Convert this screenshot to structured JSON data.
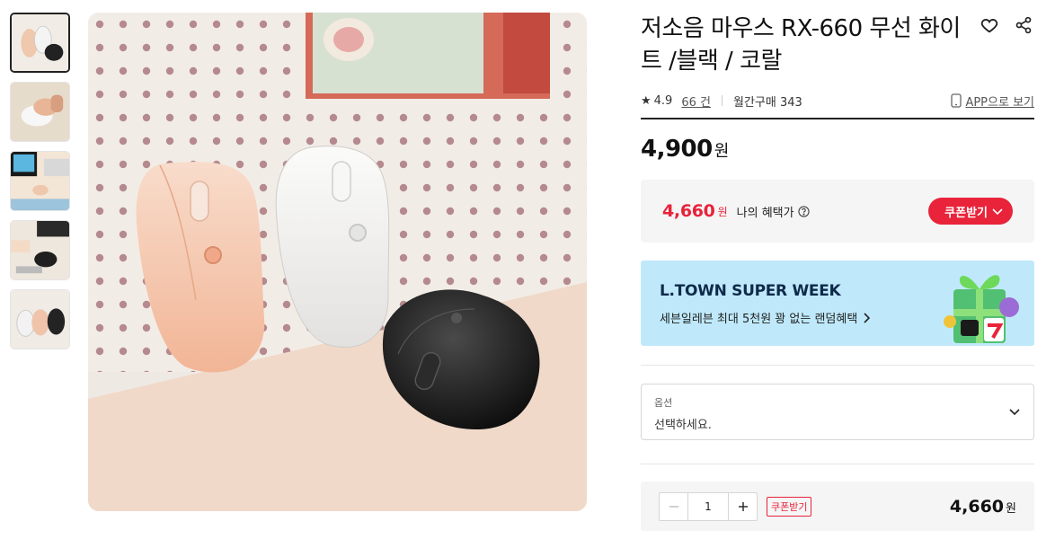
{
  "product": {
    "title": "저소음 마우스 RX-660 무선 화이트 /블랙 / 코랄",
    "rating": "4.9",
    "review_count": "66 건",
    "monthly_purchases": "월간구매 343",
    "app_link": "APP으로 보기",
    "price": "4,900",
    "price_unit": "원"
  },
  "benefit": {
    "price": "4,660",
    "unit": "원",
    "label": "나의 혜택가",
    "coupon_button": "쿠폰받기"
  },
  "banner": {
    "title": "L.TOWN SUPER WEEK",
    "subtitle": "세븐일레븐 최대 5천원 꽝 없는 랜덤혜택"
  },
  "option": {
    "label": "옵션",
    "value": "선택하세요."
  },
  "order": {
    "quantity": "1",
    "coupon_tag": "쿠폰받기",
    "total": "4,660",
    "total_unit": "원"
  },
  "gallery": {
    "thumbnail_count": 5,
    "active_index": 0
  },
  "colors": {
    "accent_red": "#e8233a",
    "banner_bg": "#bfe9fa"
  },
  "icons": {
    "wishlist": "heart-icon",
    "share": "share-icon",
    "star": "star-icon",
    "app": "phone-icon",
    "help": "question-circle-icon",
    "chevron": "chevron-down-icon"
  }
}
